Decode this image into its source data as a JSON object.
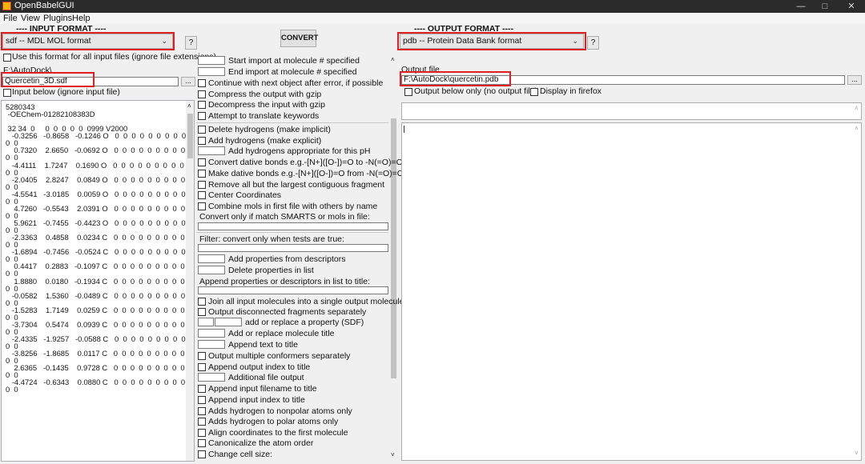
{
  "window": {
    "title": "OpenBabelGUI"
  },
  "menu": [
    "File",
    "View",
    "Plugins",
    "Help"
  ],
  "input": {
    "section_title": "---- INPUT FORMAT ----",
    "format": "sdf -- MDL MOL format",
    "help_label": "?",
    "use_all_label": "Use this format for all input files (ignore file extensions)",
    "folder": "F:\\AutoDock\\",
    "filename": "Quercetin_3D.sdf",
    "browse_label": "...",
    "below_label": "Input below (ignore input file)",
    "molecule_text": "5280343\n -OEChem-01282108383D\n\n 32 34  0     0  0  0  0  0  0999 V2000\n   -0.3256   -0.8658   -0.1246 O   0  0  0  0  0  0  0  0  0  0  0\n0  0\n    0.7320    2.6650   -0.0692 O   0  0  0  0  0  0  0  0  0  0  0\n0  0\n   -4.4111    1.7247    0.1690 O   0  0  0  0  0  0  0  0  0  0  0\n0  0\n   -2.0405    2.8247    0.0849 O   0  0  0  0  0  0  0  0  0  0  0\n0  0\n   -4.5541   -3.0185    0.0059 O   0  0  0  0  0  0  0  0  0  0  0\n0  0\n    4.7260   -0.5543    2.0391 O   0  0  0  0  0  0  0  0  0  0  0\n0  0\n    5.9621   -0.7455   -0.4423 O   0  0  0  0  0  0  0  0  0  0  0\n0  0\n   -2.3363    0.4858    0.0234 C   0  0  0  0  0  0  0  0  0  0  0\n0  0\n   -1.6894   -0.7456   -0.0524 C   0  0  0  0  0  0  0  0  0  0  0\n0  0\n    0.4417    0.2883   -0.1097 C   0  0  0  0  0  0  0  0  0  0  0\n0  0\n    1.8880    0.0180   -0.1934 C   0  0  0  0  0  0  0  0  0  0  0\n0  0\n   -0.0582    1.5360   -0.0489 C   0  0  0  0  0  0  0  0  0  0  0\n0  0\n   -1.5283    1.7149    0.0259 C   0  0  0  0  0  0  0  0  0  0  0\n0  0\n   -3.7304    0.5474    0.0939 C   0  0  0  0  0  0  0  0  0  0  0\n0  0\n   -2.4335   -1.9257   -0.0588 C   0  0  0  0  0  0  0  0  0  0  0\n0  0\n   -3.8256   -1.8685    0.0117 C   0  0  0  0  0  0  0  0  0  0  0\n0  0\n    2.6365   -0.1435    0.9728 C   0  0  0  0  0  0  0  0  0  0  0\n0  0\n   -4.4724   -0.6343    0.0880 C   0  0  0  0  0  0  0  0  0  0  0\n0  0"
  },
  "convert_label": "CONVERT",
  "options": {
    "start_import": "Start import at molecule # specified",
    "end_import": "End import at molecule # specified",
    "continue_error": "Continue with next object after error, if possible",
    "compress_gzip": "Compress the output with gzip",
    "decompress_gzip": "Decompress the input with gzip",
    "translate_keywords": "Attempt to translate keywords",
    "delete_h": "Delete hydrogens (make implicit)",
    "add_h": "Add hydrogens (make explicit)",
    "add_h_ph": "Add hydrogens appropriate for this pH",
    "dative_to": "Convert dative bonds e.g.-[N+]([O-])=O to -N(=O)=O",
    "dative_from": "Make dative bonds e.g.-[N+]([O-])=O from -N(=O)=O",
    "remove_fragment": "Remove all but the largest contiguous fragment",
    "center_coords": "Center Coordinates",
    "combine_mols": "Combine mols in first file with others by name",
    "smarts_label": "Convert only if match SMARTS or mols in file:",
    "filter_label": "Filter: convert only when tests are true:",
    "add_props": "Add properties from descriptors",
    "delete_props": "Delete properties in list",
    "append_props_label": "Append properties or descriptors in list to title:",
    "join_all": "Join all input molecules into a single output molecule",
    "output_disconnected": "Output disconnected fragments separately",
    "add_replace_property": "add or replace a property (SDF)",
    "add_replace_title": "Add or replace molecule title",
    "append_title": "Append text to title",
    "multiple_conformers": "Output multiple conformers separately",
    "append_output_index": "Append output index to title",
    "additional_output": "Additional file output",
    "append_input_filename": "Append input filename to title",
    "append_input_index": "Append input index to title",
    "h_nonpolar": "Adds hydrogen to nonpolar atoms only",
    "h_polar": "Adds hydrogen to polar atoms only",
    "align_coords": "Align coordinates to the first molecule",
    "canonicalize": "Canonicalize the atom order",
    "change_cell": "Change cell size:"
  },
  "output": {
    "section_title": "---- OUTPUT FORMAT ----",
    "format": "pdb -- Protein Data Bank format",
    "help_label": "?",
    "file_label": "Output file",
    "filepath": "F:\\AutoDock\\quercetin.pdb",
    "browse_label": "...",
    "below_only_label": "Output below only (no output file)",
    "firefox_label": "Display in firefox"
  }
}
